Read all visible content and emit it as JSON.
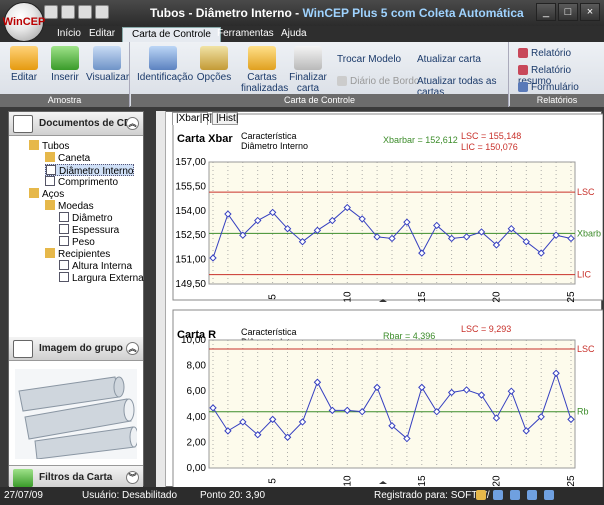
{
  "window": {
    "title_main": "Tubos - Diâmetro Interno - ",
    "title_app": "WinCEP Plus 5 com Coleta Automática",
    "logo": "WinCEP"
  },
  "tabs": [
    "Início",
    "Editar",
    "Carta de Controle",
    "Ferramentas",
    "Ajuda"
  ],
  "ribbon": {
    "amostra": {
      "label": "Amostra",
      "buttons": [
        "Editar",
        "Inserir",
        "Visualizar"
      ]
    },
    "carta": {
      "label": "Carta de Controle",
      "buttons": [
        "Identificação",
        "Opções"
      ],
      "finalizadas": [
        "Cartas",
        "finalizadas"
      ],
      "finalizar": [
        "Finalizar",
        "carta"
      ],
      "trocar_modelo": "Trocar Modelo",
      "diario": "Diário de Bordo",
      "atualizar": "Atualizar carta",
      "atualizar_todas": "Atualizar todas as cartas"
    },
    "relatorios": {
      "label": "Relatórios",
      "items": [
        "Relatório",
        "Relatório resumo",
        "Formulário"
      ]
    }
  },
  "leftpanel": {
    "documents_title": "Documentos de CEP",
    "tree": {
      "tubos": "Tubos",
      "caneta": "Caneta",
      "diametro_interno": "Diâmetro Interno",
      "comprimento": "Comprimento",
      "acos": "Aços",
      "moedas": "Moedas",
      "diametro": "Diâmetro",
      "espessura": "Espessura",
      "peso": "Peso",
      "recipientes": "Recipientes",
      "altura_interna": "Altura Interna",
      "largura_externa": "Largura Externa"
    },
    "image_title": "Imagem do grupo",
    "filters_title": "Filtros da Carta"
  },
  "chart_tabs": [
    "|Xbar|R|",
    "|Hist|"
  ],
  "chart_data": [
    {
      "type": "line",
      "title": "Carta Xbar",
      "subtitle": [
        "Característica",
        "Diâmetro Interno"
      ],
      "center_label": "Xbarbar = 152,612",
      "lsc_label": "LSC = 155,148",
      "lic_label": "LIC = 150,076",
      "y_ticks": [
        "157,00",
        "155,50",
        "154,00",
        "152,50",
        "151,00",
        "149,50"
      ],
      "ylim": [
        149.5,
        157.0
      ],
      "x_ticks": [
        5,
        10,
        15,
        20,
        25
      ],
      "limits": {
        "lsc": 155.148,
        "center": 152.612,
        "lic": 150.076
      },
      "limit_names": {
        "lsc": "LSC",
        "center": "Xbarb",
        "lic": "LIC"
      },
      "x": [
        1,
        2,
        3,
        4,
        5,
        6,
        7,
        8,
        9,
        10,
        11,
        12,
        13,
        14,
        15,
        16,
        17,
        18,
        19,
        20,
        21,
        22,
        23,
        24,
        25
      ],
      "values": [
        151.1,
        153.8,
        152.5,
        153.4,
        153.9,
        152.9,
        152.1,
        152.8,
        153.4,
        154.2,
        153.5,
        152.4,
        152.3,
        153.3,
        151.4,
        153.1,
        152.3,
        152.4,
        152.7,
        151.9,
        152.9,
        152.1,
        151.4,
        152.5,
        152.3
      ]
    },
    {
      "type": "line",
      "title": "Carta R",
      "subtitle": [
        "Característica",
        "Diâmetro Interno"
      ],
      "center_label": "Rbar = 4,396",
      "lsc_label": "LSC = 9,293",
      "y_ticks": [
        "10,00",
        "8,00",
        "6,00",
        "4,00",
        "2,00",
        "0,00"
      ],
      "ylim": [
        0,
        10
      ],
      "x_ticks": [
        5,
        10,
        15,
        20,
        25
      ],
      "limits": {
        "lsc": 9.293,
        "center": 4.396
      },
      "limit_names": {
        "lsc": "LSC",
        "center": "Rb"
      },
      "x": [
        1,
        2,
        3,
        4,
        5,
        6,
        7,
        8,
        9,
        10,
        11,
        12,
        13,
        14,
        15,
        16,
        17,
        18,
        19,
        20,
        21,
        22,
        23,
        24,
        25
      ],
      "values": [
        4.7,
        2.9,
        3.6,
        2.6,
        3.8,
        2.4,
        3.6,
        6.7,
        4.5,
        4.5,
        4.4,
        6.3,
        3.3,
        2.3,
        6.3,
        4.4,
        5.9,
        6.1,
        5.7,
        3.9,
        6.0,
        2.9,
        4.0,
        7.4,
        3.8
      ]
    }
  ],
  "status": {
    "date": "27/07/09",
    "user": "Usuário: Desabilitado",
    "point": "Ponto 20: 3,90",
    "registered": "Registrado para: SOFTW/"
  },
  "colors": {
    "lsc": "#c8302a",
    "center": "#3c8c2a",
    "series": "#3640c0",
    "plot_bg": "#fdfbec"
  }
}
